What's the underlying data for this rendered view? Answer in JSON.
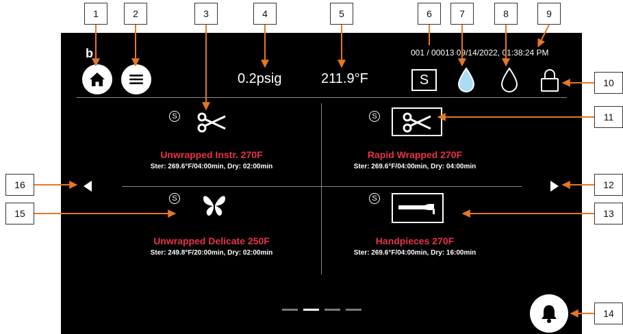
{
  "screen": {
    "logo_text": "b",
    "status": {
      "cycle_counter": "001 / 00013",
      "datetime": "09/14/2022, 01:38:24 PM"
    },
    "pressure": "0.2psig",
    "temperature": "211.9°F",
    "standby_badge": "S",
    "programs": [
      {
        "title": "Unwrapped Instr. 270F",
        "details": "Ster: 269.6°F/04:00min, Dry: 02:00min",
        "icon": "scissors-icon",
        "badge": "S",
        "framed": false
      },
      {
        "title": "Rapid Wrapped 270F",
        "details": "Ster: 269.6°F/04:00min, Dry: 04:00min",
        "icon": "scissors-icon",
        "badge": "S",
        "framed": true
      },
      {
        "title": "Unwrapped Delicate 250F",
        "details": "Ster: 249.8°F/20:00min, Dry: 02:00min",
        "icon": "butterfly-icon",
        "badge": "S",
        "framed": false
      },
      {
        "title": "Handpieces 270F",
        "details": "Ster: 269.6°F/04:00min, Dry: 16:00min",
        "icon": "handpiece-icon",
        "badge": "S",
        "framed": true
      }
    ],
    "pagination": {
      "total": 4,
      "active_index": 1
    }
  },
  "callouts": [
    "1",
    "2",
    "3",
    "4",
    "5",
    "6",
    "7",
    "8",
    "9",
    "10",
    "11",
    "12",
    "13",
    "14",
    "15",
    "16"
  ],
  "colors": {
    "screen_bg": "#000000",
    "program_title": "#e8334a",
    "callout_line": "#e87722",
    "water_drop": "#a9dcf5"
  }
}
